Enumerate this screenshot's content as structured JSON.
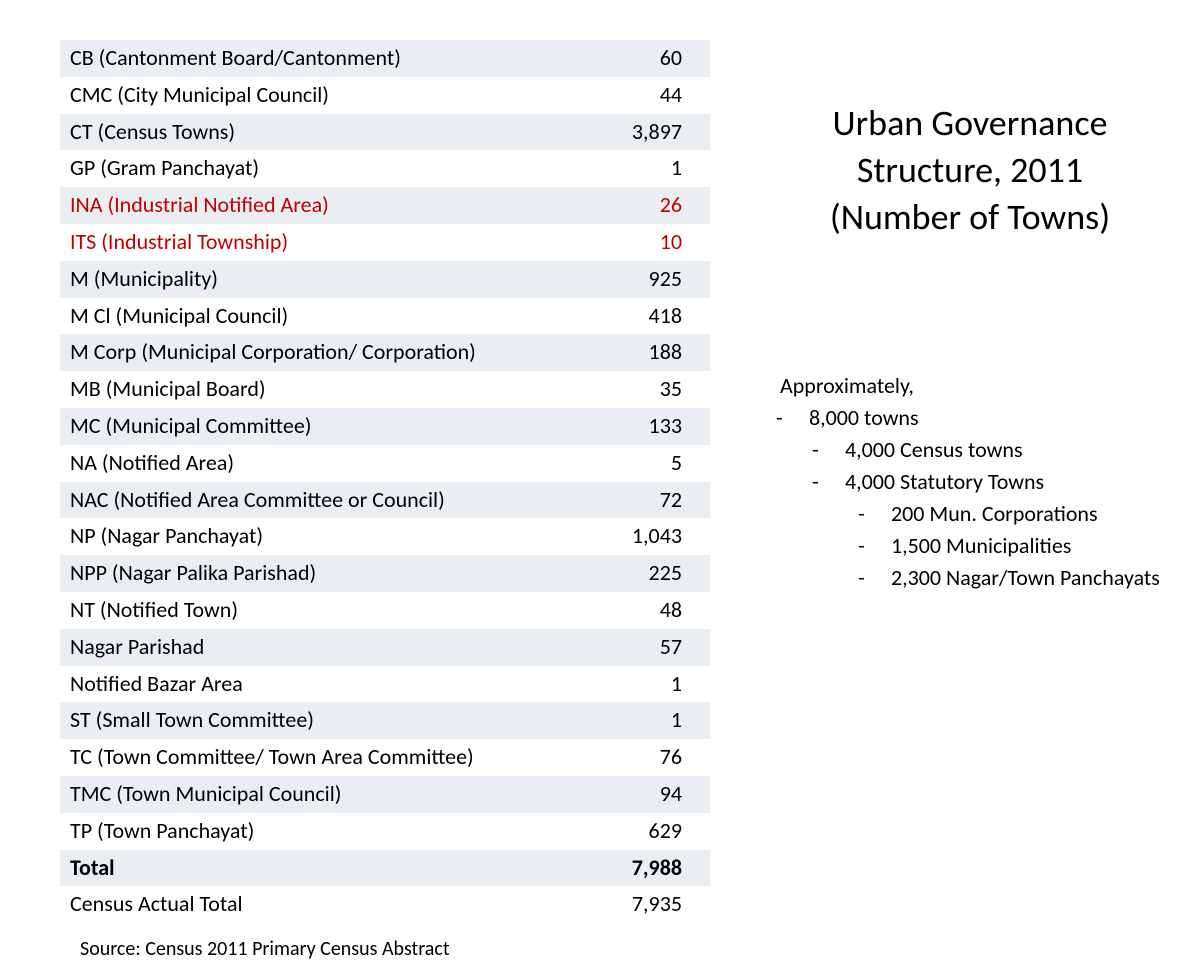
{
  "title_line1": "Urban Governance",
  "title_line2": "Structure, 2011",
  "title_line3": "(Number of Towns)",
  "table": {
    "rows": [
      {
        "label": "CB (Cantonment Board/Cantonment)",
        "value": "60",
        "highlight": false
      },
      {
        "label": "CMC (City Municipal Council)",
        "value": "44",
        "highlight": false
      },
      {
        "label": "CT (Census Towns)",
        "value": "3,897",
        "highlight": false
      },
      {
        "label": "GP (Gram Panchayat)",
        "value": "1",
        "highlight": false
      },
      {
        "label": "INA (Industrial Notified Area)",
        "value": "26",
        "highlight": true
      },
      {
        "label": "ITS (Industrial Township)",
        "value": "10",
        "highlight": true
      },
      {
        "label": "M (Municipality)",
        "value": "925",
        "highlight": false
      },
      {
        "label": "M Cl (Municipal Council)",
        "value": "418",
        "highlight": false
      },
      {
        "label": "M Corp (Municipal Corporation/ Corporation)",
        "value": "188",
        "highlight": false
      },
      {
        "label": "MB (Municipal Board)",
        "value": "35",
        "highlight": false
      },
      {
        "label": "MC (Municipal Committee)",
        "value": "133",
        "highlight": false
      },
      {
        "label": "NA (Notified Area)",
        "value": "5",
        "highlight": false
      },
      {
        "label": "NAC (Notified Area Committee or Council)",
        "value": "72",
        "highlight": false
      },
      {
        "label": "NP (Nagar Panchayat)",
        "value": "1,043",
        "highlight": false
      },
      {
        "label": "NPP (Nagar Palika Parishad)",
        "value": "225",
        "highlight": false
      },
      {
        "label": "NT (Notified Town)",
        "value": "48",
        "highlight": false
      },
      {
        "label": "Nagar Parishad",
        "value": "57",
        "highlight": false
      },
      {
        "label": "Notified Bazar Area",
        "value": "1",
        "highlight": false
      },
      {
        "label": "ST (Small Town Committee)",
        "value": "1",
        "highlight": false
      },
      {
        "label": "TC (Town Committee/ Town Area Committee)",
        "value": "76",
        "highlight": false
      },
      {
        "label": "TMC (Town Municipal Council)",
        "value": "94",
        "highlight": false
      },
      {
        "label": "TP (Town Panchayat)",
        "value": "629",
        "highlight": false
      }
    ],
    "total_row": {
      "label": "Total",
      "value": "7,988"
    },
    "census_row": {
      "label": "Census Actual Total",
      "value": "7,935"
    }
  },
  "bullets": {
    "intro": "Approximately,",
    "items": [
      {
        "text": "8,000 towns",
        "level": 1
      },
      {
        "text": "4,000 Census towns",
        "level": 2
      },
      {
        "text": "4,000 Statutory Towns",
        "level": 2
      },
      {
        "text": "200 Mun. Corporations",
        "level": 3
      },
      {
        "text": "1,500 Municipalities",
        "level": 3
      },
      {
        "text": "2,300 Nagar/Town Panchayats",
        "level": 3
      }
    ]
  },
  "source": "Source: Census 2011 Primary Census Abstract"
}
